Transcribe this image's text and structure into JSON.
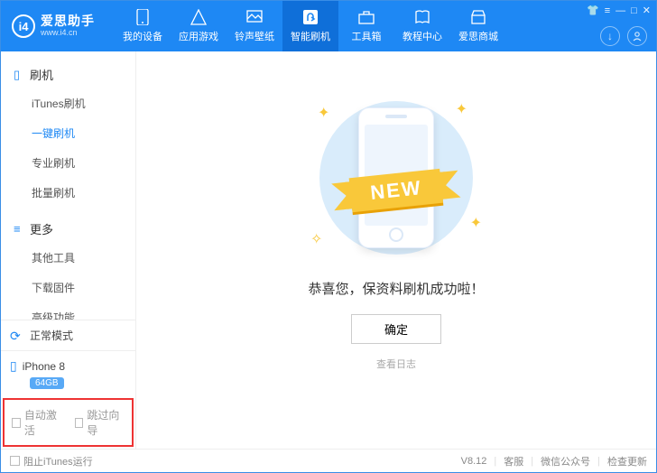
{
  "header": {
    "title": "爱思助手",
    "url": "www.i4.cn",
    "tabs": [
      "我的设备",
      "应用游戏",
      "铃声壁纸",
      "智能刷机",
      "工具箱",
      "教程中心",
      "爱思商城"
    ]
  },
  "sidebar": {
    "group1": {
      "title": "刷机",
      "items": [
        "iTunes刷机",
        "一键刷机",
        "专业刷机",
        "批量刷机"
      ]
    },
    "group2": {
      "title": "更多",
      "items": [
        "其他工具",
        "下载固件",
        "高级功能"
      ]
    },
    "mode": "正常模式",
    "device": {
      "name": "iPhone 8",
      "storage": "64GB"
    },
    "checks": [
      "自动激活",
      "跳过向导"
    ]
  },
  "main": {
    "ribbon": "NEW",
    "message": "恭喜您，保资料刷机成功啦！",
    "ok": "确定",
    "log": "查看日志"
  },
  "footer": {
    "block_itunes": "阻止iTunes运行",
    "version": "V8.12",
    "support": "客服",
    "wechat": "微信公众号",
    "update": "检查更新"
  }
}
